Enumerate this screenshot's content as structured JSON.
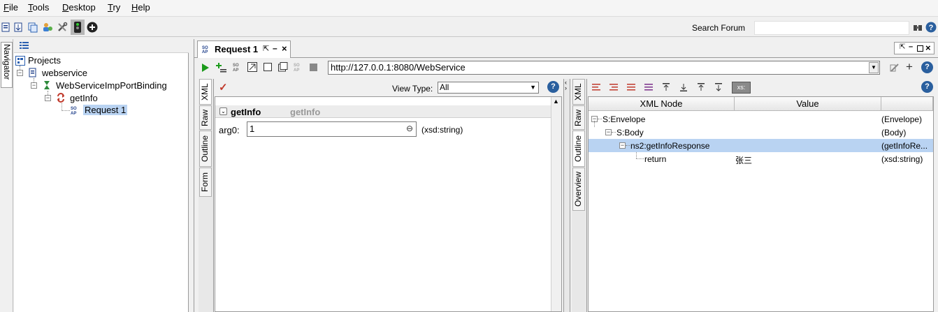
{
  "menu": [
    "File",
    "Tools",
    "Desktop",
    "Try",
    "Help"
  ],
  "toolbar": {
    "search_label": "Search Forum",
    "search_value": "",
    "icons": [
      "new-project-icon",
      "import-icon",
      "save-all-icon",
      "plugin-icon",
      "preferences-icon",
      "proxy-icon",
      "add-icon"
    ]
  },
  "navigator": {
    "tab_label": "Navigator",
    "tree": {
      "root": "Projects",
      "project": "webservice",
      "binding": "WebServiceImpPortBinding",
      "operation": "getInfo",
      "request": "Request 1"
    }
  },
  "editor": {
    "tab_title": "Request 1",
    "url": "http://127.0.0.1:8080/WebService",
    "request": {
      "side_tabs": [
        "XML",
        "Raw",
        "Outline",
        "Form"
      ],
      "view_type_label": "View Type:",
      "view_type_value": "All",
      "section_title": "getInfo",
      "section_subtitle": "getInfo",
      "field_label": "arg0:",
      "field_value": "1",
      "field_type": "(xsd:string)"
    },
    "response": {
      "side_tabs": [
        "XML",
        "Raw",
        "Outline",
        "Overview"
      ],
      "xs_label": "xs:",
      "columns": [
        "XML Node",
        "Value",
        ""
      ],
      "rows": [
        {
          "node": "S:Envelope",
          "value": "",
          "type": "(Envelope)"
        },
        {
          "node": "S:Body",
          "value": "",
          "type": "(Body)"
        },
        {
          "node": "ns2:getInfoResponse",
          "value": "",
          "type": "(getInfoRe..."
        },
        {
          "node": "return",
          "value": "张三",
          "type": "(xsd:string)"
        }
      ]
    }
  },
  "colors": {
    "selection": "#b9d3f2",
    "accent_blue": "#2a5f9e",
    "run_green": "#1a9a1a"
  }
}
